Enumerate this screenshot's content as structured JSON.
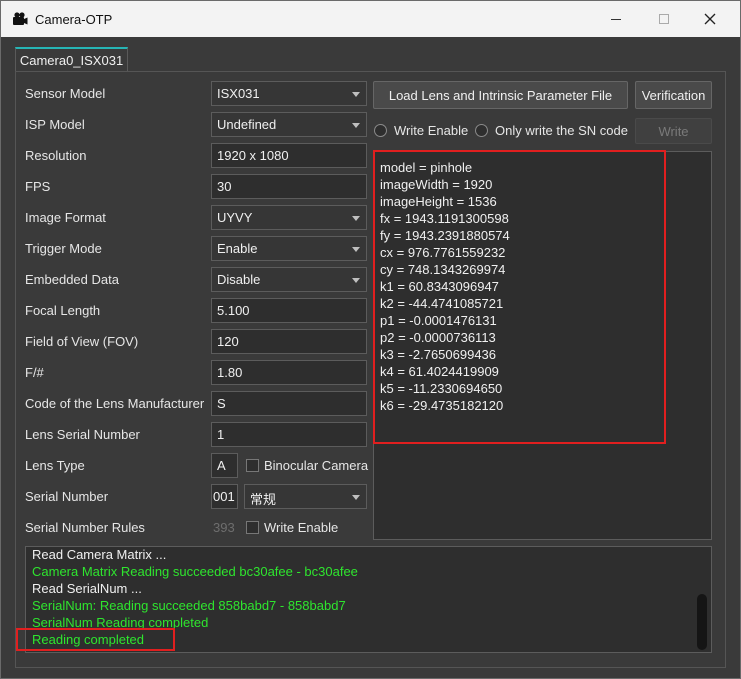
{
  "window": {
    "title": "Camera-OTP",
    "icon": "camera-icon"
  },
  "tab": {
    "label": "Camera0_ISX031"
  },
  "form": {
    "sensor_model": {
      "label": "Sensor Model",
      "value": "ISX031"
    },
    "isp_model": {
      "label": "ISP Model",
      "value": "Undefined"
    },
    "resolution": {
      "label": "Resolution",
      "value": "1920 x 1080"
    },
    "fps": {
      "label": "FPS",
      "value": "30"
    },
    "image_format": {
      "label": "Image Format",
      "value": "UYVY"
    },
    "trigger_mode": {
      "label": "Trigger Mode",
      "value": "Enable"
    },
    "embedded_data": {
      "label": "Embedded Data",
      "value": "Disable"
    },
    "focal_length": {
      "label": "Focal Length",
      "value": "5.100"
    },
    "fov": {
      "label": "Field of View (FOV)",
      "value": "120"
    },
    "fnumber": {
      "label": "F/#",
      "value": "1.80"
    },
    "lens_manufacturer": {
      "label": "Code of the Lens Manufacturer",
      "value": "S"
    },
    "lens_serial": {
      "label": "Lens Serial Number",
      "value": "1"
    },
    "lens_type": {
      "label": "Lens Type",
      "value": "A",
      "binocular_label": "Binocular Camera"
    },
    "serial_number": {
      "label": "Serial Number",
      "value": "001",
      "rule_value": "常规"
    },
    "serial_rules": {
      "label": "Serial Number Rules",
      "value": "393",
      "write_enable_label": "Write Enable"
    }
  },
  "actions": {
    "load_file": "Load Lens and Intrinsic Parameter File",
    "verification": "Verification",
    "write_enable": "Write Enable",
    "only_sn": "Only write the SN code",
    "write": "Write"
  },
  "params": [
    "model = pinhole",
    "imageWidth = 1920",
    "imageHeight = 1536",
    "fx = 1943.1191300598",
    "fy = 1943.2391880574",
    "cx = 976.7761559232",
    "cy = 748.1343269974",
    "k1 = 60.8343096947",
    "k2 = -44.4741085721",
    "p1 = -0.0001476131",
    "p2 = -0.0000736113",
    "k3 = -2.7650699436",
    "k4 = 61.4024419909",
    "k5 = -11.2330694650",
    "k6 = -29.4735182120"
  ],
  "log": [
    {
      "text": "Read Camera Matrix ...",
      "color": "#f0f0f0"
    },
    {
      "text": "Camera Matrix Reading succeeded bc30afee - bc30afee",
      "color": "#2ee52e"
    },
    {
      "text": "Read SerialNum ...",
      "color": "#f0f0f0"
    },
    {
      "text": "SerialNum:  Reading succeeded 858babd7 - 858babd7",
      "color": "#2ee52e"
    },
    {
      "text": "SerialNum Reading completed",
      "color": "#2ee52e"
    },
    {
      "text": "Reading completed",
      "color": "#2ee52e"
    }
  ]
}
